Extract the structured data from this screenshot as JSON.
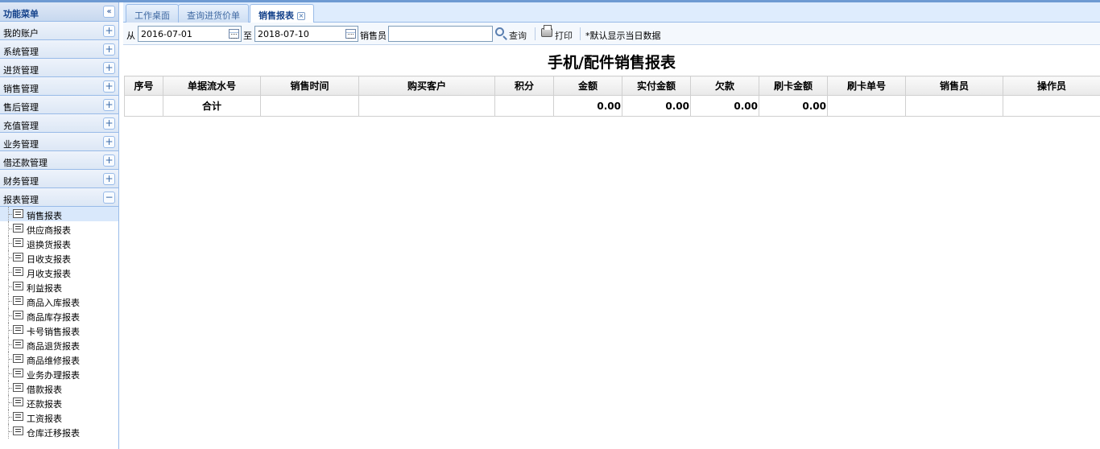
{
  "sidebar": {
    "title": "功能菜单",
    "collapse_glyph": "«",
    "sections": [
      {
        "label": "我的账户",
        "toggle": "+"
      },
      {
        "label": "系统管理",
        "toggle": "+"
      },
      {
        "label": "进货管理",
        "toggle": "+"
      },
      {
        "label": "销售管理",
        "toggle": "+"
      },
      {
        "label": "售后管理",
        "toggle": "+"
      },
      {
        "label": "充值管理",
        "toggle": "+"
      },
      {
        "label": "业务管理",
        "toggle": "+"
      },
      {
        "label": "借还款管理",
        "toggle": "+"
      },
      {
        "label": "财务管理",
        "toggle": "+"
      },
      {
        "label": "报表管理",
        "toggle": "−"
      }
    ],
    "report_items": [
      "销售报表",
      "供应商报表",
      "退换货报表",
      "日收支报表",
      "月收支报表",
      "利益报表",
      "商品入库报表",
      "商品库存报表",
      "卡号销售报表",
      "商品退货报表",
      "商品维修报表",
      "业务办理报表",
      "借款报表",
      "还款报表",
      "工资报表",
      "仓库迁移报表"
    ],
    "selected_item": "销售报表"
  },
  "tabs": [
    {
      "label": "工作桌面",
      "active": false
    },
    {
      "label": "查询进货价单",
      "active": false
    },
    {
      "label": "销售报表",
      "active": true,
      "close": "×"
    }
  ],
  "toolbar": {
    "from_label": "从",
    "from_date": "2016-07-01",
    "to_label": "至",
    "to_date": "2018-07-10",
    "seller_label": "销售员",
    "seller_value": "",
    "query_label": "查询",
    "print_label": "打印",
    "note": "*默认显示当日数据"
  },
  "report": {
    "title": "手机/配件销售报表",
    "columns": [
      "序号",
      "单据流水号",
      "销售时间",
      "购买客户",
      "积分",
      "金额",
      "实付金额",
      "欠款",
      "刷卡金额",
      "刷卡单号",
      "销售员",
      "操作员"
    ],
    "total_row": {
      "label": "合计",
      "amount": "0.00",
      "paid": "0.00",
      "debt": "0.00",
      "card_amount": "0.00"
    }
  },
  "colors": {
    "accent": "#15428b",
    "border": "#99bbe8",
    "tab_bar": "#deecfd"
  }
}
